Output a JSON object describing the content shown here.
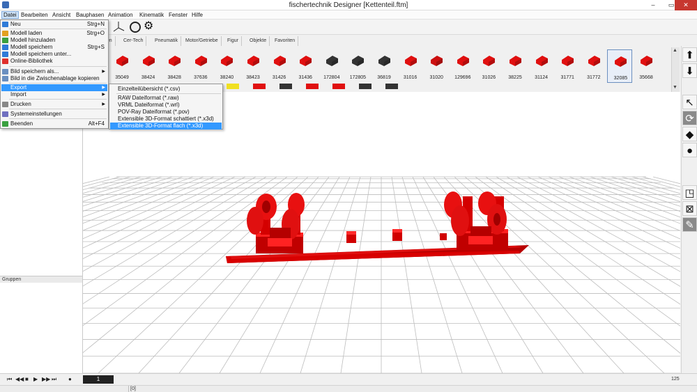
{
  "window": {
    "title": "fischertechnik Designer [Kettenteil.ftm]",
    "minimize": "–",
    "maximize": "▭",
    "close": "✕"
  },
  "menubar": [
    "Datei",
    "Bearbeiten",
    "Ansicht",
    "Bauphasen",
    "Animation",
    "Kinematik",
    "Fenster",
    "Hilfe"
  ],
  "tabs": [
    "tten",
    "Cer-Tech",
    "Pneumatik",
    "Motor/Getriebe",
    "Figur",
    "Objekte",
    "Favoriten"
  ],
  "parts": [
    {
      "id": "35049",
      "color": "#e01010"
    },
    {
      "id": "38424",
      "color": "#e01010"
    },
    {
      "id": "38428",
      "color": "#e01010"
    },
    {
      "id": "37636",
      "color": "#e01010"
    },
    {
      "id": "38240",
      "color": "#e01010"
    },
    {
      "id": "38423",
      "color": "#e01010"
    },
    {
      "id": "31426",
      "color": "#e01010"
    },
    {
      "id": "31436",
      "color": "#e01010"
    },
    {
      "id": "172804",
      "color": "#333333"
    },
    {
      "id": "172805",
      "color": "#333333"
    },
    {
      "id": "36819",
      "color": "#333333"
    },
    {
      "id": "31016",
      "color": "#e01010"
    },
    {
      "id": "31020",
      "color": "#cc1010"
    },
    {
      "id": "129696",
      "color": "#e01010"
    },
    {
      "id": "31026",
      "color": "#e01010"
    },
    {
      "id": "38225",
      "color": "#e01010"
    },
    {
      "id": "31124",
      "color": "#e01010"
    },
    {
      "id": "31771",
      "color": "#e01010"
    },
    {
      "id": "31772",
      "color": "#e01010"
    },
    {
      "id": "32085",
      "color": "#e01010"
    },
    {
      "id": "35668",
      "color": "#e01010"
    }
  ],
  "selected_part": "32085",
  "file_menu": {
    "items": [
      {
        "label": "Neu",
        "shortcut": "Strg+N"
      },
      {
        "label": "Modell laden",
        "shortcut": "Strg+O"
      },
      {
        "label": "Modell hinzuladen",
        "shortcut": ""
      },
      {
        "label": "Modell speichern",
        "shortcut": "Strg+S"
      },
      {
        "label": "Modell speichern unter...",
        "shortcut": ""
      },
      {
        "label": "Online-Bibliothek",
        "shortcut": ""
      },
      {
        "label": "Bild speichern als...",
        "shortcut": ""
      },
      {
        "label": "Bild in die Zwischenablage kopieren",
        "shortcut": ""
      },
      {
        "label": "Export",
        "shortcut": ""
      },
      {
        "label": "Import",
        "shortcut": ""
      },
      {
        "label": "Drucken",
        "shortcut": ""
      },
      {
        "label": "Systemeinstellungen",
        "shortcut": ""
      },
      {
        "label": "Beenden",
        "shortcut": "Alt+F4"
      }
    ]
  },
  "export_submenu": [
    "Einzelteilübersicht (*.csv)",
    "RAW Dateiformat (*.raw)",
    "VRML Dateiformat (*.wrl)",
    "POV-Ray Dateiformat (*.pov)",
    "Extensible 3D-Format schattiert (*.x3d)",
    "Extensible 3D-Format flach (*.x3d)"
  ],
  "panels": {
    "groups_label": "Gruppen"
  },
  "timeline": {
    "current_frame": "1",
    "total_frames": "125"
  },
  "status": {
    "text": "[0]"
  },
  "colors": {
    "part_red": "#e01010",
    "highlight": "#3399ff",
    "close_button": "#c7372f"
  },
  "icons": {
    "toolbar": [
      "axis-icon",
      "circle-icon",
      "gear-icon"
    ],
    "right_tools": [
      "pointer-icon",
      "rotate-icon",
      "eraser-icon",
      "paint-drop-icon",
      "new-group-icon",
      "delete-group-icon",
      "edit-group-icon"
    ],
    "right_glyphs": [
      "⬆",
      "⬇",
      "↖",
      "⟳",
      "◆",
      "●",
      "◳",
      "⊠",
      "✎"
    ],
    "playback": [
      "⏮",
      "◀◀",
      "■",
      "▶",
      "▶▶",
      "⏭",
      "●"
    ]
  }
}
